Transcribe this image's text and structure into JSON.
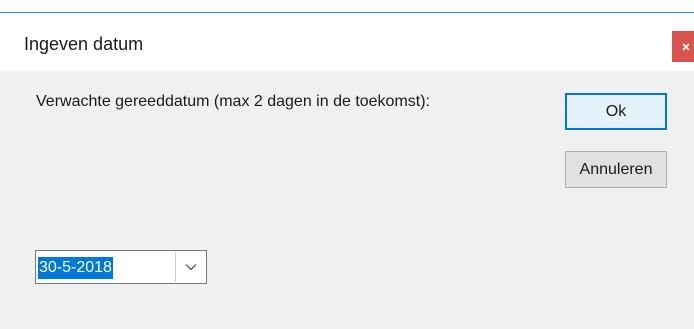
{
  "window": {
    "title": "Ingeven datum",
    "close_glyph": "x",
    "close_color": "#d9534f",
    "accent_color": "#0078d7"
  },
  "form": {
    "prompt": "Verwachte gereeddatum (max 2 dagen in de toekomst):",
    "date_value": "30-5-2018",
    "dropdown_icon": "chevron-down-icon"
  },
  "buttons": {
    "ok_label": "Ok",
    "cancel_label": "Annuleren"
  }
}
